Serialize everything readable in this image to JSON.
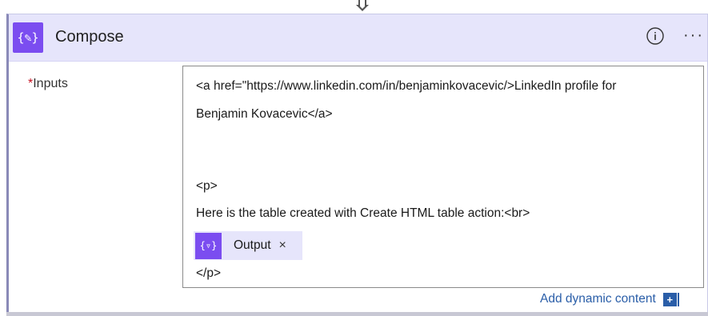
{
  "action": {
    "title": "Compose",
    "icon": "compose-curly-braces-icon",
    "info_icon": "info-icon",
    "more_label": "···"
  },
  "inputs": {
    "required_marker": "*",
    "label": "Inputs",
    "lines": [
      "<a href=\"https://www.linkedin.com/in/benjaminkovacevic/>LinkedIn profile for",
      "Benjamin Kovacevic</a>",
      "<p>",
      "Here is the table created with Create HTML table action:<br>",
      "</p>"
    ],
    "token": {
      "label": "Output",
      "close": "×",
      "icon": "dynamic-content-icon"
    }
  },
  "add_dynamic_content": {
    "label": "Add dynamic content",
    "icon": "plus-icon"
  },
  "colors": {
    "header_bg": "#e6e5fb",
    "accent": "#7b4df0",
    "link": "#2a5ea8",
    "required": "#c50f1f"
  }
}
